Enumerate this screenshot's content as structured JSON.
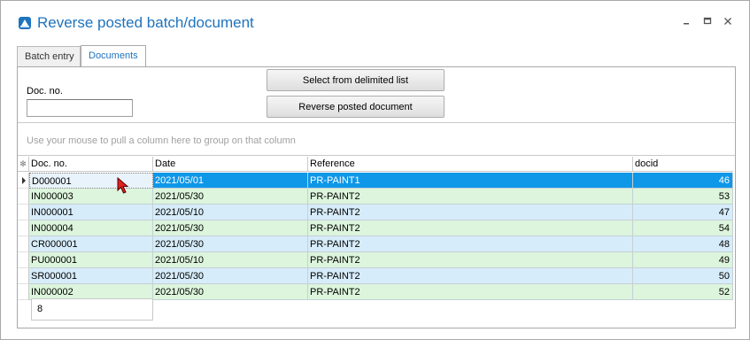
{
  "window": {
    "title": "Reverse posted batch/document",
    "minimize_icon": "minimize-icon",
    "maximize_icon": "maximize-icon",
    "close_icon": "close-icon"
  },
  "tabs": [
    {
      "label": "Batch entry",
      "active": false
    },
    {
      "label": "Documents",
      "active": true
    }
  ],
  "filter": {
    "docno_label": "Doc. no.",
    "docno_value": "",
    "select_list_button": "Select from delimited list",
    "reverse_button": "Reverse posted document"
  },
  "group_hint": "Use your mouse to pull a column here to group on that column",
  "grid": {
    "columns": [
      "Doc. no.",
      "Date",
      "Reference",
      "docid"
    ],
    "rows": [
      {
        "docno": "D000001",
        "date": "2021/05/01",
        "reference": "PR-PAINT1",
        "docid": "46",
        "style": "selected"
      },
      {
        "docno": "IN000003",
        "date": "2021/05/30",
        "reference": "PR-PAINT2",
        "docid": "53",
        "style": "green"
      },
      {
        "docno": "IN000001",
        "date": "2021/05/10",
        "reference": "PR-PAINT2",
        "docid": "47",
        "style": "blue"
      },
      {
        "docno": "IN000004",
        "date": "2021/05/30",
        "reference": "PR-PAINT2",
        "docid": "54",
        "style": "green"
      },
      {
        "docno": "CR000001",
        "date": "2021/05/30",
        "reference": "PR-PAINT2",
        "docid": "48",
        "style": "blue"
      },
      {
        "docno": "PU000001",
        "date": "2021/05/10",
        "reference": "PR-PAINT2",
        "docid": "49",
        "style": "green"
      },
      {
        "docno": "SR000001",
        "date": "2021/05/30",
        "reference": "PR-PAINT2",
        "docid": "50",
        "style": "blue"
      },
      {
        "docno": "IN000002",
        "date": "2021/05/30",
        "reference": "PR-PAINT2",
        "docid": "52",
        "style": "green"
      }
    ],
    "record_count": "8"
  },
  "colors": {
    "accent": "#1e73be",
    "selected_row": "#0f97e8",
    "row_green": "#dcf5dc",
    "row_blue": "#d6ecfa"
  }
}
